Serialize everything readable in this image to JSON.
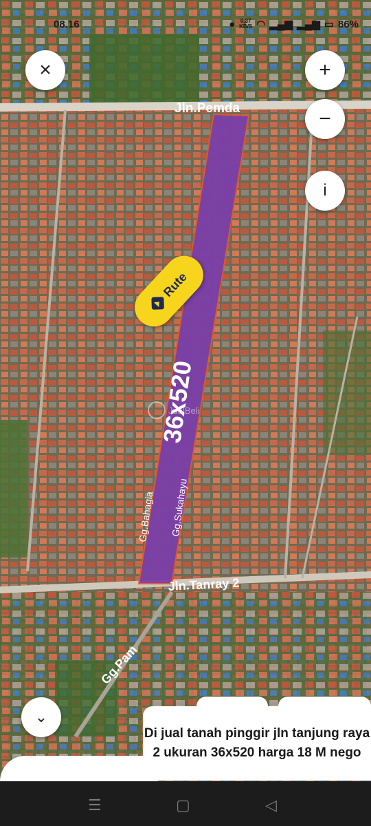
{
  "status_bar": {
    "time": "08.16",
    "network_speed": "0.37",
    "network_unit": "KB/S",
    "battery": "86%"
  },
  "controls": {
    "close": "×",
    "zoom_in": "+",
    "zoom_out": "−",
    "info": "i",
    "collapse": "⌄"
  },
  "route_button": {
    "label": "Rute",
    "color": "#f7d51d"
  },
  "map": {
    "parcel_label": "36x520",
    "parcel_color": "#7a3fa8",
    "roads": [
      "Jln.Pemda",
      "Jln.Tanray 2",
      "Gg.Bahagia",
      "Gg.Sukahayu",
      "Gg.Pam"
    ]
  },
  "watermark": {
    "text": "JualBeli"
  },
  "caption": {
    "text": "Di jual tanah pinggir jln tanjung raya 2  ukuran 36x520 harga 18 M nego"
  },
  "nav_bar": {
    "recent": "☰",
    "home": "▢",
    "back": "◁"
  }
}
